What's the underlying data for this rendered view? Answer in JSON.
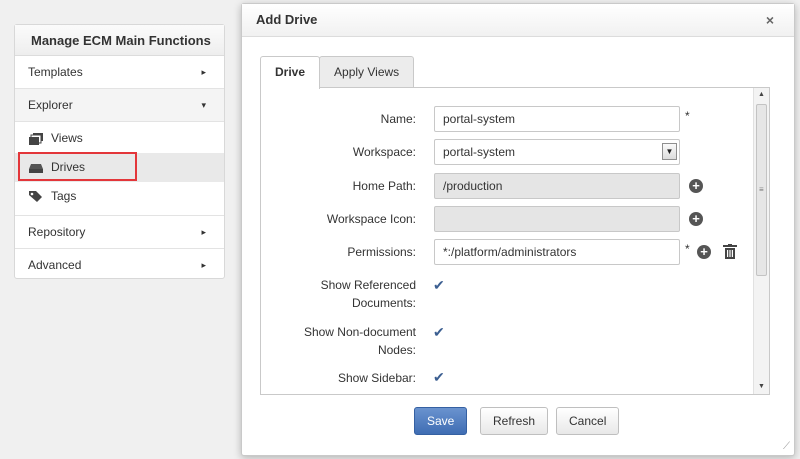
{
  "left_menu": {
    "title": "Manage ECM Main Functions",
    "sections": [
      {
        "label": "Templates",
        "arrow": "▸"
      },
      {
        "label": "Explorer",
        "arrow": "▾"
      },
      {
        "label": "Repository",
        "arrow": "▸"
      },
      {
        "label": "Advanced",
        "arrow": "▸"
      }
    ],
    "explorer_items": [
      {
        "label": "Views",
        "icon": "views-icon"
      },
      {
        "label": "Drives",
        "icon": "drive-icon"
      },
      {
        "label": "Tags",
        "icon": "tag-icon"
      }
    ],
    "highlight_color": "#e3363a"
  },
  "dialog": {
    "title": "Add Drive",
    "close": "×",
    "tabs": [
      "Drive",
      "Apply Views"
    ],
    "form": {
      "name_label": "Name:",
      "name_value": "portal-system",
      "workspace_label": "Workspace:",
      "workspace_value": "portal-system",
      "home_path_label": "Home Path:",
      "home_path_value": "/production",
      "workspace_icon_label": "Workspace Icon:",
      "workspace_icon_value": "",
      "permissions_label": "Permissions:",
      "permissions_value": "*:/platform/administrators",
      "required_mark": "*",
      "show_referenced_label_1": "Show Referenced",
      "show_referenced_label_2": "Documents:",
      "show_non_document_label_1": "Show Non-document",
      "show_non_document_label_2": "Nodes:",
      "show_sidebar_label": "Show Sidebar:",
      "show_referenced_checked": true,
      "show_non_document_checked": true,
      "show_sidebar_checked": true
    },
    "buttons": {
      "save": "Save",
      "refresh": "Refresh",
      "cancel": "Cancel"
    },
    "primary_color": "#4a78bd"
  }
}
